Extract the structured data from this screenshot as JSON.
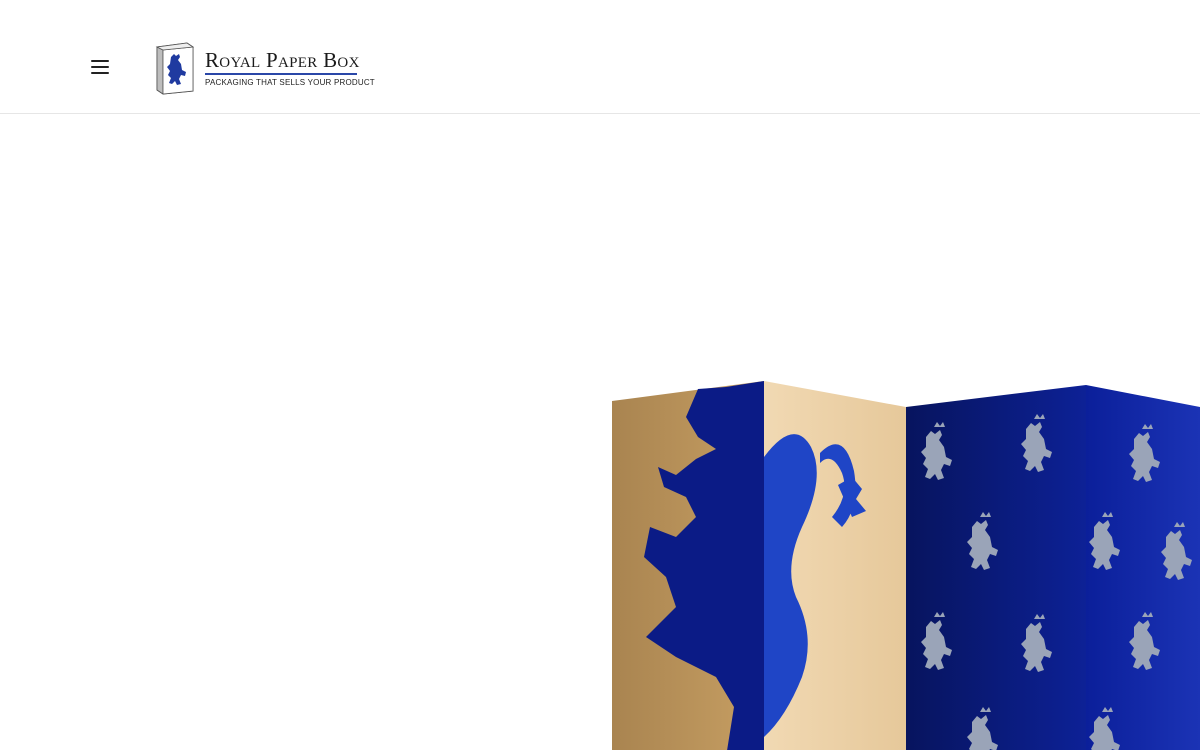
{
  "header": {
    "menu_icon": "hamburger-menu-icon",
    "logo": {
      "title": "Royal Paper Box",
      "tagline": "PACKAGING THAT SELLS YOUR PRODUCT",
      "emblem_icon": "lion-box-emblem-icon"
    }
  },
  "hero": {
    "image": "folding-box-lion-pattern-image",
    "colors": {
      "kraft": "#c9a56b",
      "royal_blue": "#0d2196",
      "navy": "#0a1a6e",
      "lion_grey": "#9aa4b8"
    }
  },
  "colors": {
    "accent": "#2a47a8",
    "divider": "#e6e6e6"
  }
}
